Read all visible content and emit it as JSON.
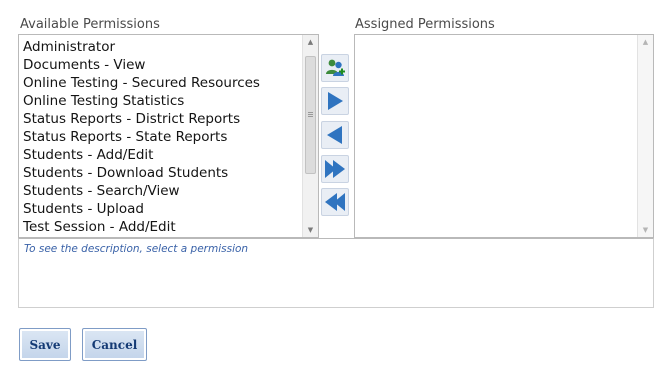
{
  "available": {
    "label": "Available Permissions",
    "items": [
      "Administrator",
      "Documents - View",
      "Online Testing - Secured Resources",
      "Online Testing Statistics",
      "Status Reports - District Reports",
      "Status Reports - State Reports",
      "Students - Add/Edit",
      "Students - Download Students",
      "Students - Search/View",
      "Students - Upload",
      "Test Session - Add/Edit"
    ]
  },
  "assigned": {
    "label": "Assigned Permissions",
    "items": []
  },
  "description": {
    "placeholder": "To see the description, select a permission"
  },
  "buttons": {
    "save": "Save",
    "cancel": "Cancel"
  },
  "icons": {
    "add_all_users": "users-add-icon",
    "move_right": "arrow-right-icon",
    "move_left": "arrow-left-icon",
    "move_all_right": "double-arrow-right-icon",
    "move_all_left": "double-arrow-left-icon"
  },
  "colors": {
    "arrow_blue": "#2f74c0",
    "button_text": "#143a74",
    "description_text": "#3a62a8"
  }
}
